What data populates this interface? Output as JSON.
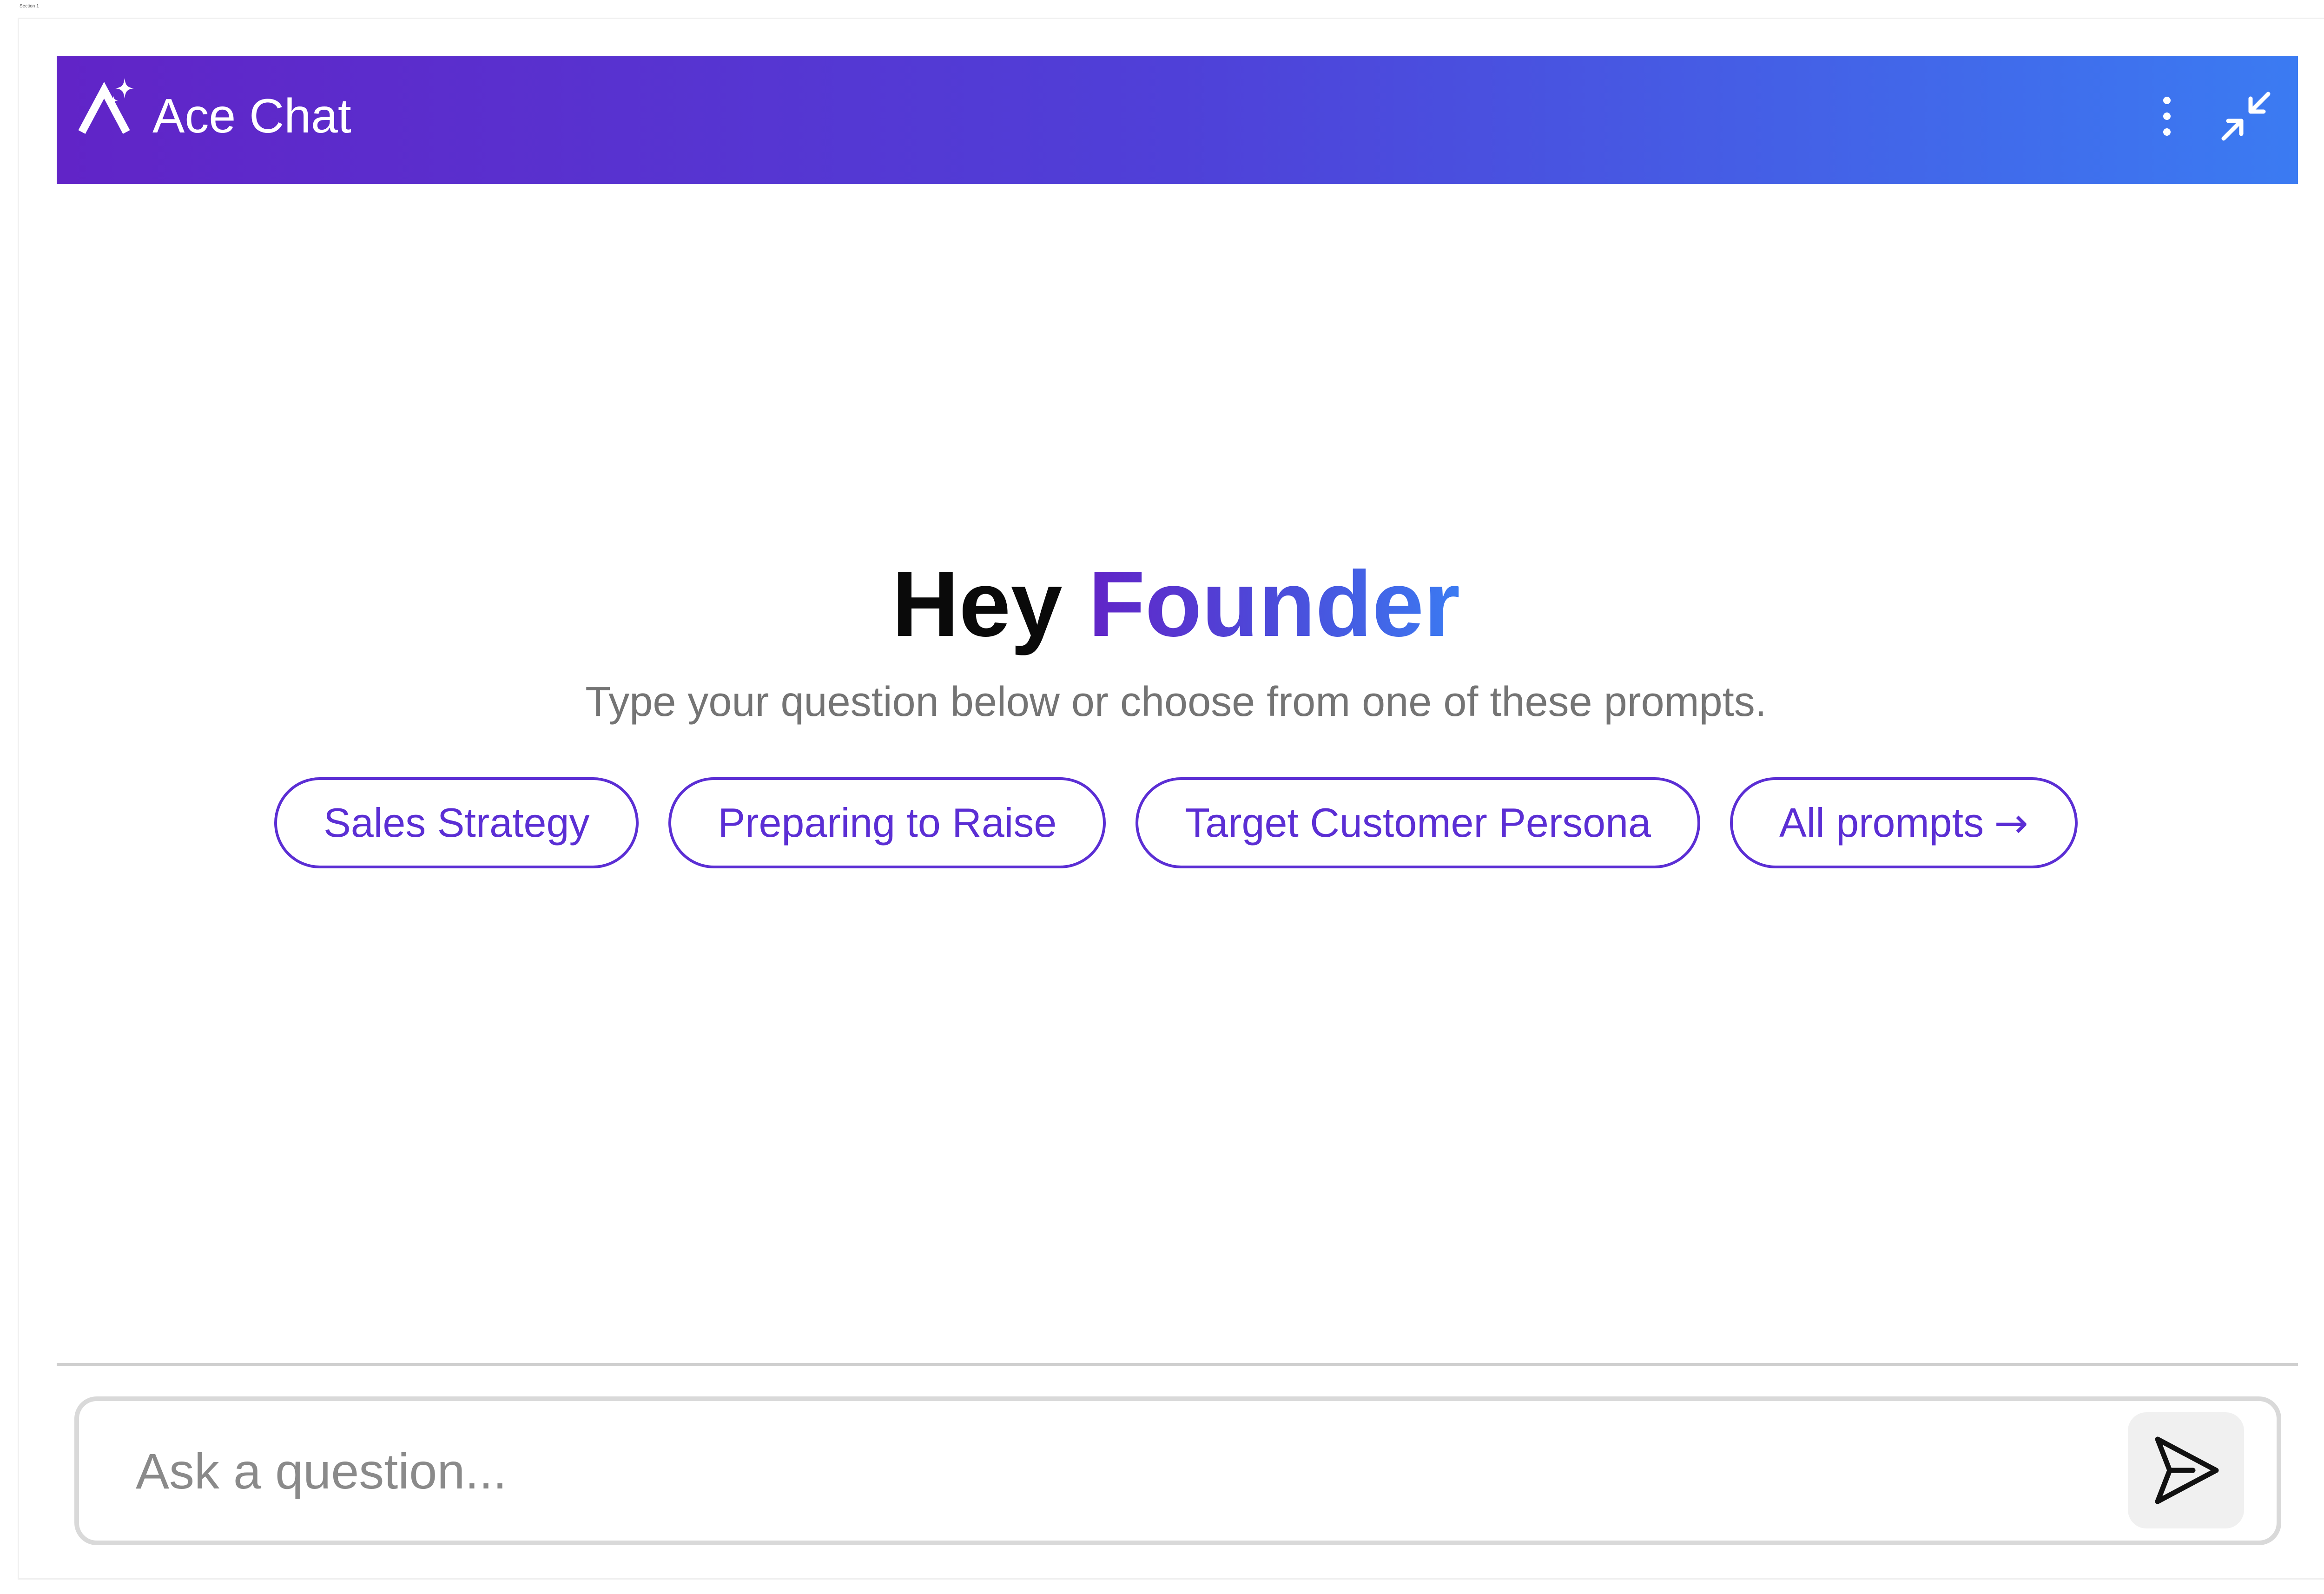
{
  "section_tag": "Section 1",
  "header": {
    "logo_icon": "ace-logo-icon",
    "title": "Ace Chat",
    "menu_icon": "vertical-dots-icon",
    "minimize_icon": "collapse-arrows-icon"
  },
  "greeting": {
    "prefix": "Hey",
    "name": "Founder",
    "subtitle": "Type your question below or choose from one of these prompts."
  },
  "prompts": [
    {
      "label": "Sales Strategy"
    },
    {
      "label": "Preparing to Raise"
    },
    {
      "label": "Target Customer Persona"
    },
    {
      "label": "All prompts",
      "icon": "arrow-right-icon",
      "arrow": "→"
    }
  ],
  "composer": {
    "placeholder": "Ask a question...",
    "send_icon": "send-icon"
  },
  "colors": {
    "header_start": "#6124c7",
    "header_end": "#3b7bf2",
    "accent": "#5b2ed4"
  }
}
